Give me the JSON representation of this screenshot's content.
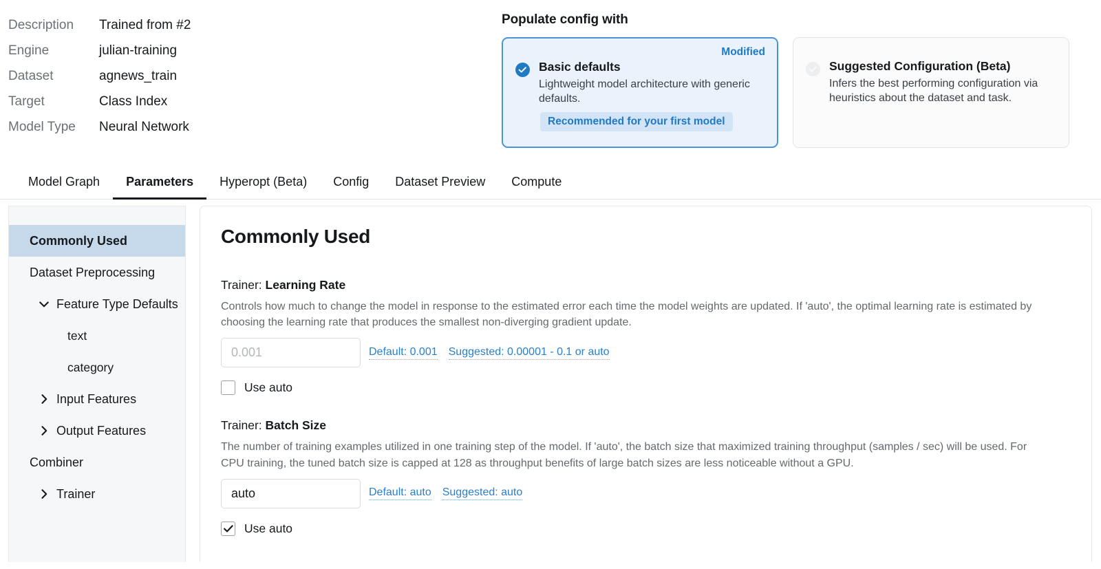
{
  "meta": {
    "rows": [
      {
        "label": "Description",
        "value": "Trained from #2"
      },
      {
        "label": "Engine",
        "value": "julian-training"
      },
      {
        "label": "Dataset",
        "value": "agnews_train"
      },
      {
        "label": "Target",
        "value": "Class Index"
      },
      {
        "label": "Model Type",
        "value": "Neural Network"
      }
    ]
  },
  "populate": {
    "title": "Populate config with",
    "cards": [
      {
        "title": "Basic defaults",
        "desc": "Lightweight model architecture with generic defaults.",
        "pill": "Recommended for your first model",
        "badge": "Modified",
        "selected": true
      },
      {
        "title": "Suggested Configuration (Beta)",
        "desc": "Infers the best performing configuration via heuristics about the dataset and task.",
        "pill": "",
        "badge": "",
        "selected": false
      }
    ]
  },
  "tabs": [
    {
      "label": "Model Graph",
      "active": false
    },
    {
      "label": "Parameters",
      "active": true
    },
    {
      "label": "Hyperopt (Beta)",
      "active": false
    },
    {
      "label": "Config",
      "active": false
    },
    {
      "label": "Dataset Preview",
      "active": false
    },
    {
      "label": "Compute",
      "active": false
    }
  ],
  "sidebar": {
    "items": [
      {
        "label": "Commonly Used",
        "selected": true,
        "indent": "top",
        "caret": "none"
      },
      {
        "label": "Dataset Preprocessing",
        "selected": false,
        "indent": "top",
        "caret": "none"
      },
      {
        "label": "Feature Type Defaults",
        "selected": false,
        "indent": "branch",
        "caret": "down"
      },
      {
        "label": "text",
        "selected": false,
        "indent": "child",
        "caret": "none"
      },
      {
        "label": "category",
        "selected": false,
        "indent": "child",
        "caret": "none"
      },
      {
        "label": "Input Features",
        "selected": false,
        "indent": "branch",
        "caret": "right"
      },
      {
        "label": "Output Features",
        "selected": false,
        "indent": "branch",
        "caret": "right"
      },
      {
        "label": "Combiner",
        "selected": false,
        "indent": "top",
        "caret": "none"
      },
      {
        "label": "Trainer",
        "selected": false,
        "indent": "branch",
        "caret": "right"
      }
    ]
  },
  "panel": {
    "title": "Commonly Used",
    "fields": [
      {
        "prefix": "Trainer: ",
        "name": "Learning Rate",
        "description": "Controls how much to change the model in response to the estimated error each time the model weights are updated. If 'auto', the optimal learning rate is estimated by choosing the learning rate that produces the smallest non-diverging gradient update.",
        "value": "",
        "placeholder": "0.001",
        "default_hint": "Default: 0.001",
        "suggested_hint": "Suggested: 0.00001 - 0.1 or auto",
        "checkbox_label": "Use auto",
        "checked": false
      },
      {
        "prefix": "Trainer: ",
        "name": "Batch Size",
        "description": "The number of training examples utilized in one training step of the model. If 'auto', the batch size that maximized training throughput (samples / sec) will be used. For CPU training, the tuned batch size is capped at 128 as throughput benefits of large batch sizes are less noticeable without a GPU.",
        "value": "auto",
        "placeholder": "",
        "default_hint": "Default: auto",
        "suggested_hint": "Suggested: auto",
        "checkbox_label": "Use auto",
        "checked": true
      }
    ]
  },
  "colors": {
    "accent": "#2b7fc9",
    "selected_card_bg": "#eaf2fb",
    "selected_card_border": "#4a94d8",
    "sidebar_selected_bg": "#c6d9eb",
    "pill_bg": "#d3e4f6"
  }
}
